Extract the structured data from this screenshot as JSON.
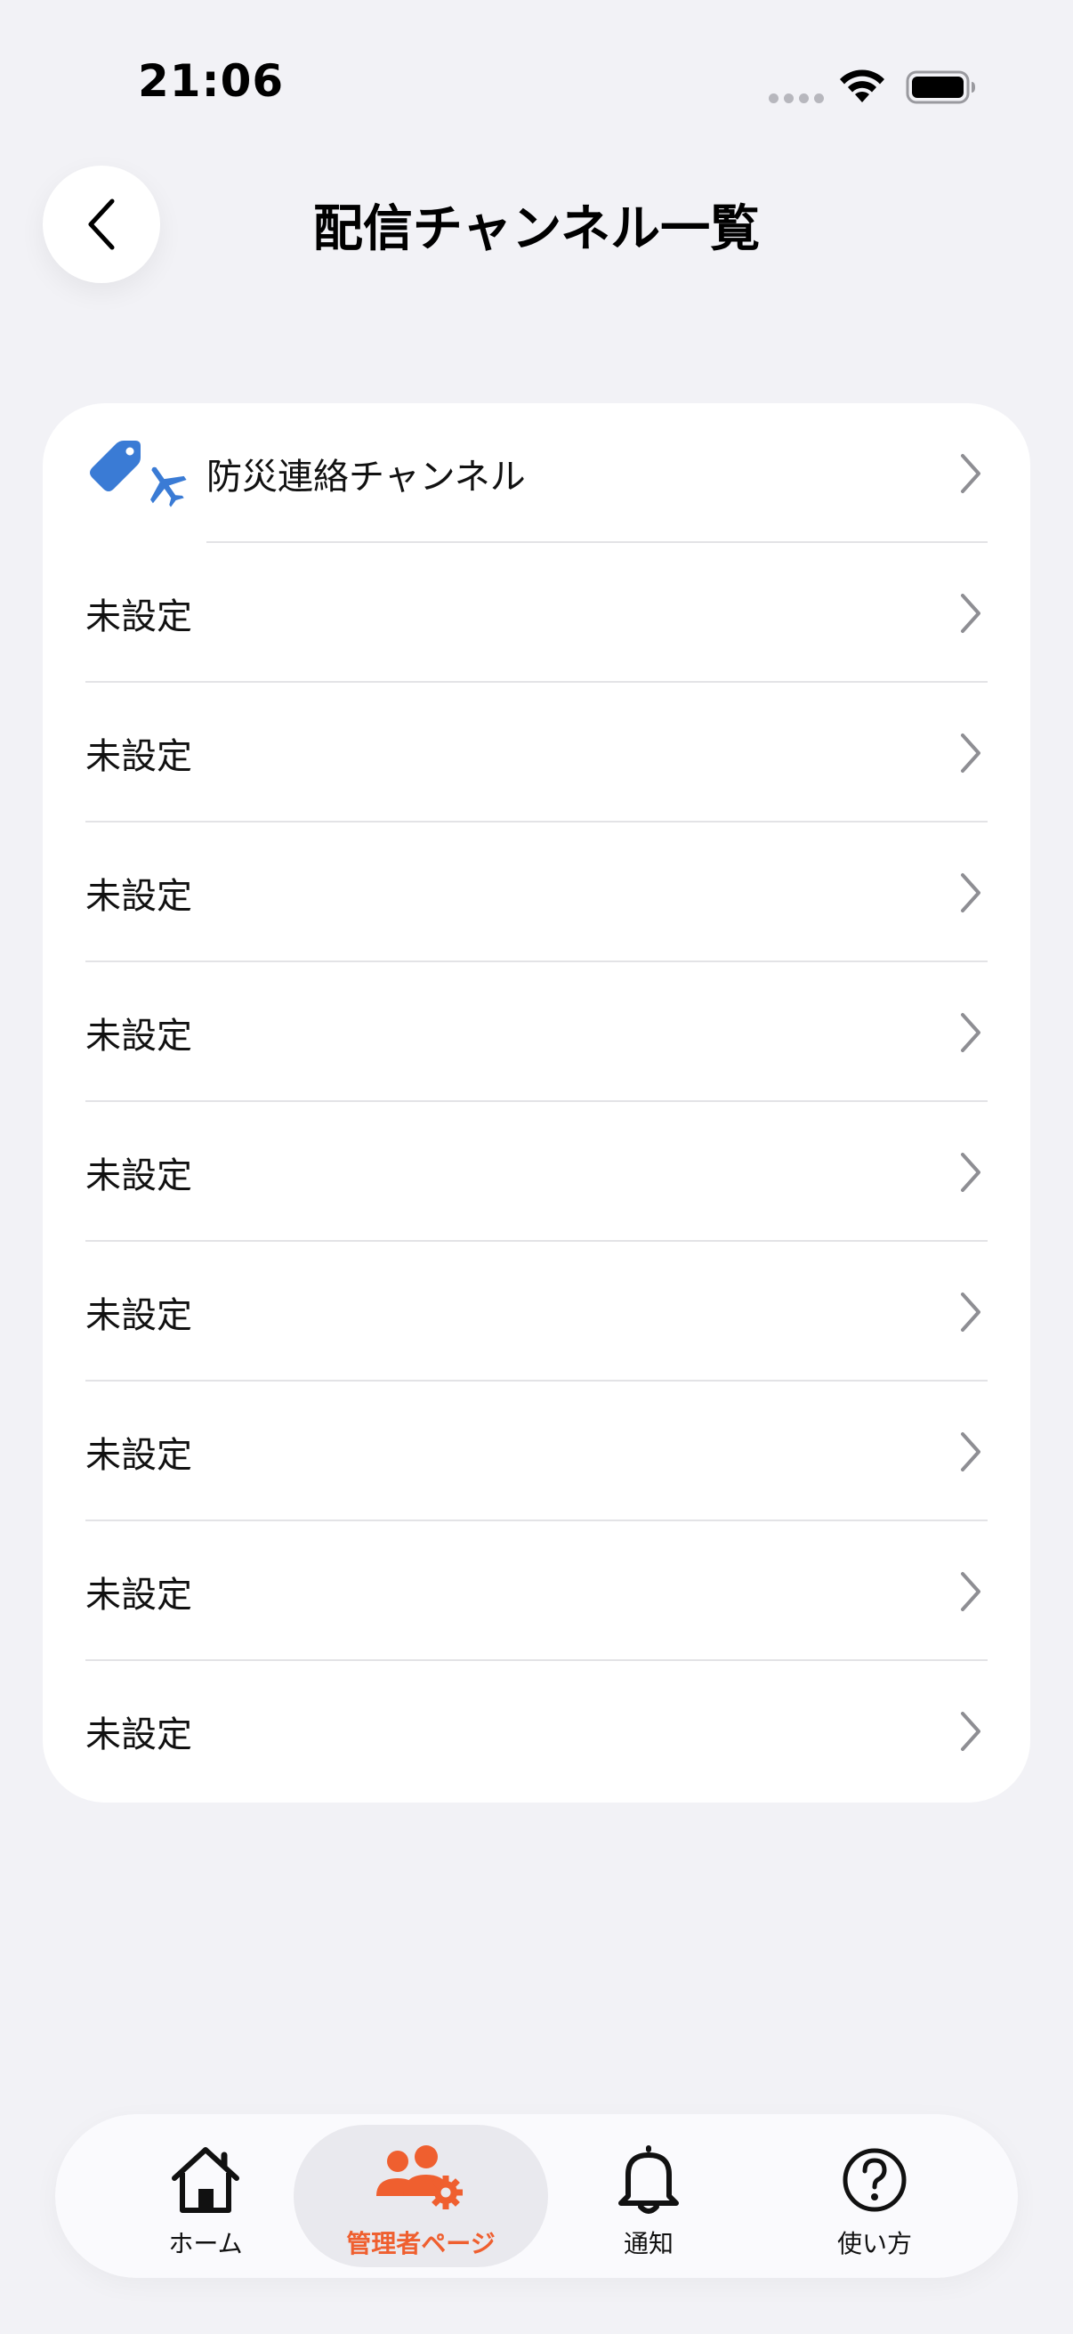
{
  "status_bar": {
    "time": "21:06"
  },
  "header": {
    "title": "配信チャンネル一覧",
    "back_icon": "chevron-left-icon"
  },
  "channels": [
    {
      "label": "防災連絡チャンネル",
      "icon": "tag-airplane-icon"
    },
    {
      "label": "未設定"
    },
    {
      "label": "未設定"
    },
    {
      "label": "未設定"
    },
    {
      "label": "未設定"
    },
    {
      "label": "未設定"
    },
    {
      "label": "未設定"
    },
    {
      "label": "未設定"
    },
    {
      "label": "未設定"
    },
    {
      "label": "未設定"
    }
  ],
  "tab_bar": {
    "items": [
      {
        "label": "ホーム",
        "icon": "home-icon",
        "active": false
      },
      {
        "label": "管理者ページ",
        "icon": "admin-users-gear-icon",
        "active": true
      },
      {
        "label": "通知",
        "icon": "bell-icon",
        "active": false
      },
      {
        "label": "使い方",
        "icon": "question-circle-icon",
        "active": false
      }
    ]
  },
  "colors": {
    "background": "#f2f2f6",
    "accent": "#ef5f2f",
    "channel_icon": "#3a7bd5",
    "chevron": "#8e8e93"
  }
}
